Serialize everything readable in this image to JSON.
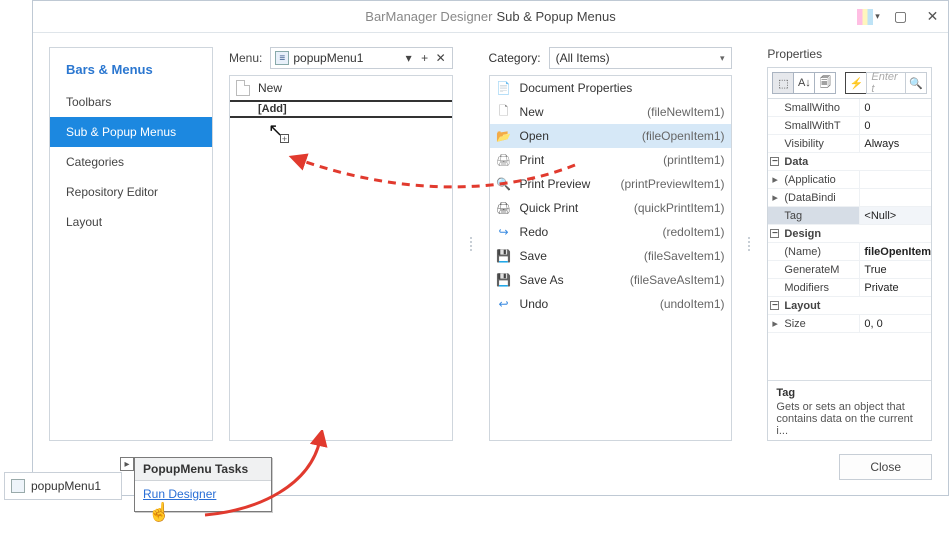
{
  "title": {
    "pre": "BarManager Designer",
    "main": "Sub & Popup Menus"
  },
  "sidebar": {
    "title": "Bars & Menus",
    "items": [
      "Toolbars",
      "Sub & Popup Menus",
      "Categories",
      "Repository Editor",
      "Layout"
    ],
    "active_index": 1
  },
  "menu_panel": {
    "label": "Menu:",
    "current": "popupMenu1",
    "rows": [
      "New"
    ],
    "add_label": "[Add]"
  },
  "category_panel": {
    "label": "Category:",
    "selected": "(All Items)",
    "items": [
      {
        "icon": "docprop",
        "label": "Document Properties",
        "tech": ""
      },
      {
        "icon": "new",
        "label": "New",
        "tech": "(fileNewItem1)"
      },
      {
        "icon": "open",
        "label": "Open",
        "tech": "(fileOpenItem1)",
        "selected": true
      },
      {
        "icon": "print",
        "label": "Print",
        "tech": "(printItem1)"
      },
      {
        "icon": "prev",
        "label": "Print Preview",
        "tech": "(printPreviewItem1)"
      },
      {
        "icon": "quick",
        "label": "Quick Print",
        "tech": "(quickPrintItem1)"
      },
      {
        "icon": "redo",
        "label": "Redo",
        "tech": "(redoItem1)"
      },
      {
        "icon": "save",
        "label": "Save",
        "tech": "(fileSaveItem1)"
      },
      {
        "icon": "saveas",
        "label": "Save As",
        "tech": "(fileSaveAsItem1)"
      },
      {
        "icon": "undo",
        "label": "Undo",
        "tech": "(undoItem1)"
      }
    ]
  },
  "properties": {
    "title": "Properties",
    "search_placeholder": "Enter t",
    "rows": [
      {
        "type": "kv",
        "key": "SmallWitho",
        "val": "0"
      },
      {
        "type": "kv",
        "key": "SmallWithT",
        "val": "0"
      },
      {
        "type": "kv",
        "key": "Visibility",
        "val": "Always"
      },
      {
        "type": "cat",
        "key": "Data"
      },
      {
        "type": "kv",
        "key": "(Applicatio",
        "val": "",
        "exp": true
      },
      {
        "type": "kv",
        "key": "(DataBindi",
        "val": "",
        "exp": true
      },
      {
        "type": "kv",
        "key": "Tag",
        "val": "<Null>",
        "hl": true
      },
      {
        "type": "cat",
        "key": "Design"
      },
      {
        "type": "kv",
        "key": "(Name)",
        "val": "fileOpenItem",
        "bold": true
      },
      {
        "type": "kv",
        "key": "GenerateM",
        "val": "True"
      },
      {
        "type": "kv",
        "key": "Modifiers",
        "val": "Private"
      },
      {
        "type": "cat",
        "key": "Layout"
      },
      {
        "type": "kv",
        "key": "Size",
        "val": "0, 0",
        "exp": true
      }
    ],
    "description": {
      "title": "Tag",
      "body": "Gets or sets an object that contains data on the current i..."
    }
  },
  "close_label": "Close",
  "tray": {
    "name": "popupMenu1"
  },
  "smart_tag": {
    "title": "PopupMenu Tasks",
    "link": "Run Designer"
  }
}
